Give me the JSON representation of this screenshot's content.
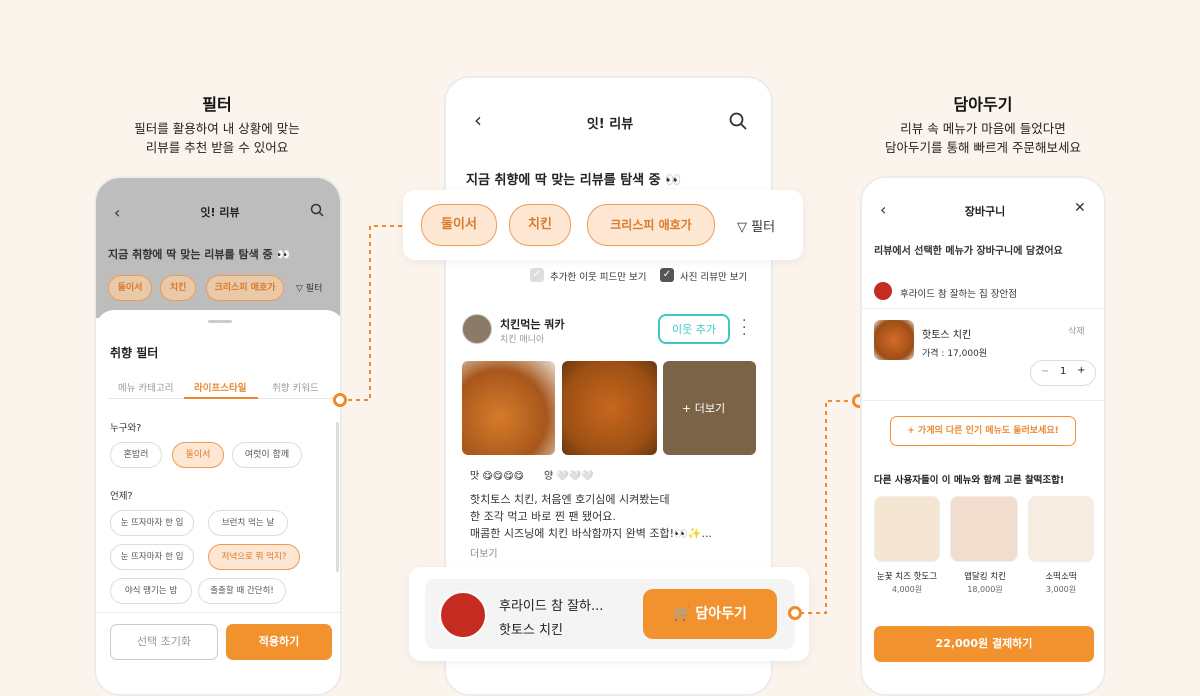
{
  "left": {
    "title": "필터",
    "desc1": "필터를 활용하여 내 상황에 맞는",
    "desc2": "리뷰를 추천 받을 수 있어요",
    "header": "잇! 리뷰",
    "headline": "지금 취향에 딱 맞는 리뷰를 탐색 중 👀",
    "chips": [
      "둘이서",
      "치킨",
      "크리스피 애호가"
    ],
    "filter_label": "필터",
    "sheet_title": "취향 필터",
    "tabs": [
      "메뉴 카테고리",
      "라이프스타일",
      "취향 키워드"
    ],
    "who_label": "누구와?",
    "who": [
      "혼밥러",
      "둘이서",
      "여럿이 함께"
    ],
    "when_label": "언제?",
    "when": [
      "눈 뜨자마자 한 입",
      "브런치 먹는 날",
      "눈 뜨자마자 한 입",
      "저녁으로 뭐 먹지?",
      "야식 땡기는 밤",
      "출출할 때 간단히!"
    ],
    "reset": "선택 초기화",
    "apply": "적용하기"
  },
  "center": {
    "header": "잇! 리뷰",
    "headline": "지금 취향에 딱 맞는 리뷰를 탐색 중 👀",
    "chips": [
      "둘이서",
      "치킨",
      "크리스피 애호가"
    ],
    "filter_label": "필터",
    "check1": "추가한 이웃 피드만 보기",
    "check2": "사진 리뷰만 보기",
    "user_name": "치킨먹는 쿼카",
    "user_sub": "치킨 매니아",
    "follow": "이웃 추가",
    "more_photos": "+ 더보기",
    "taste_label": "맛 😋😋😋😋",
    "amount_label": "양 🤍🤍🤍",
    "review1": "핫치토스 치킨, 처음엔 호기심에 시켜봤는데",
    "review2": "한 조각 먹고 바로 찐 팬 됐어요.",
    "review3": "매콤한 시즈닝에 치킨 바삭함까지 완벽 조합!👀✨...",
    "more": "더보기",
    "store": "후라이드 참 잘하...",
    "menu": "핫토스 치킨",
    "cart_btn": "담아두기"
  },
  "right": {
    "title": "담아두기",
    "desc1": "리뷰 속 메뉴가 마음에 들었다면",
    "desc2": "담아두기를 통해 빠르게 주문해보세요",
    "header": "장바구니",
    "notice": "리뷰에서 선택한 메뉴가 장바구니에 담겼어요",
    "store": "후라이드 참 잘하는 집 장안점",
    "item": "핫토스 치킨",
    "delete": "삭제",
    "price": "가격 : 17,000원",
    "qty": "1",
    "more_menu": "+ 가게의 다른 인기 메뉴도 둘러보세요!",
    "rec_title": "다른 사용자들이 이 메뉴와 함께 고른 찰떡조합!",
    "recs": [
      {
        "name": "눈꽃 치즈 핫도그",
        "price": "4,000원"
      },
      {
        "name": "맵달킹 치킨",
        "price": "18,000원"
      },
      {
        "name": "소떡소떡",
        "price": "3,000원"
      }
    ],
    "pay": "22,000원 결제하기"
  },
  "colors": {
    "accent": "#f2922f",
    "chip_bg": "#fde7d3",
    "teal": "#3ec7c4"
  }
}
